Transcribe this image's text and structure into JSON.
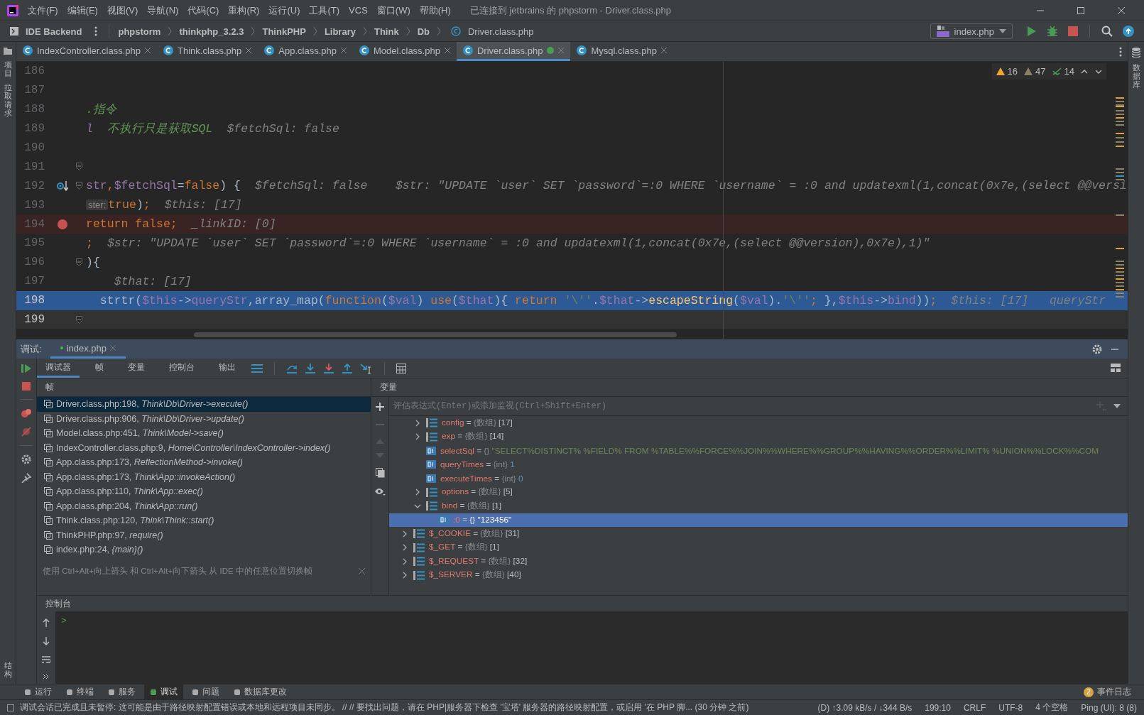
{
  "menu_bar": {
    "items": [
      "文件(F)",
      "编辑(E)",
      "视图(V)",
      "导航(N)",
      "代码(C)",
      "重构(R)",
      "运行(U)",
      "工具(T)",
      "VCS",
      "窗口(W)",
      "帮助(H)"
    ],
    "title": "已连接到 jetbrains 的 phpstorm - Driver.class.php"
  },
  "nav_bar": {
    "project": "IDE Backend",
    "breadcrumbs": [
      "phpstorm",
      "thinkphp_3.2.3",
      "ThinkPHP",
      "Library",
      "Think",
      "Db"
    ],
    "file": "Driver.class.php",
    "run_config": "index.php"
  },
  "side_panels": {
    "left_top": [
      "项目",
      "拉取请求"
    ],
    "left_bottom": [
      "结构"
    ],
    "right": [
      "数据库"
    ]
  },
  "editor_tabs": [
    {
      "label": "IndexController.class.php",
      "selected": false,
      "badge": false
    },
    {
      "label": "Think.class.php",
      "selected": false,
      "badge": false
    },
    {
      "label": "App.class.php",
      "selected": false,
      "badge": false
    },
    {
      "label": "Model.class.php",
      "selected": false,
      "badge": false
    },
    {
      "label": "Driver.class.php",
      "selected": true,
      "badge": true
    },
    {
      "label": "Mysql.class.php",
      "selected": false,
      "badge": false
    }
  ],
  "inspections": {
    "warnings": "16",
    "weak_warnings": "47",
    "typos": "14"
  },
  "code_lines": [
    {
      "number": "186",
      "kind": "plain",
      "fold": false
    },
    {
      "number": "187",
      "kind": "plain",
      "fold": false
    },
    {
      "number": "188",
      "kind": "plain",
      "fold": false,
      "code": [
        {
          "kind": "doc",
          "t": ".指令"
        }
      ]
    },
    {
      "number": "189",
      "kind": "plain",
      "fold": false,
      "code": [
        {
          "kind": "docvar",
          "t": "l"
        },
        {
          "kind": "doc",
          "t": "  不执行只是获取SQL"
        }
      ],
      "hint": "$fetchSql: false"
    },
    {
      "number": "190",
      "kind": "plain",
      "fold": false
    },
    {
      "number": "191",
      "kind": "plain",
      "fold": true
    },
    {
      "number": "192",
      "kind": "step",
      "fold": true,
      "code": [
        {
          "kind": "var",
          "t": "str"
        },
        {
          "kind": "kw",
          "t": ","
        },
        {
          "kind": "var",
          "t": "$fetchSql"
        },
        {
          "kind": "plain",
          "t": "="
        },
        {
          "kind": "kw",
          "t": "false"
        },
        {
          "kind": "plain",
          "t": ") {"
        }
      ],
      "hint": "$fetchSql: false    $str: \"UPDATE `user` SET `password`=:0 WHERE `username` = :0 and updatexml(1,concat(0x7e,(select @@versi"
    },
    {
      "number": "193",
      "kind": "plain",
      "fold": false,
      "inlay": "ster:",
      "code": [
        {
          "kind": "kw",
          "t": "true"
        },
        {
          "kind": "plain",
          "t": ")"
        },
        {
          "kind": "kw",
          "t": ";"
        }
      ],
      "hint": "$this: [17]"
    },
    {
      "number": "194",
      "kind": "breakpoint",
      "fold": false,
      "code": [
        {
          "kind": "kw",
          "t": "return false;"
        }
      ],
      "hint": "_linkID: [0]"
    },
    {
      "number": "195",
      "kind": "plain",
      "fold": false,
      "code": [
        {
          "kind": "kw",
          "t": ";"
        }
      ],
      "hint": "$str: \"UPDATE `user` SET `password`=:0 WHERE `username` = :0 and updatexml(1,concat(0x7e,(select @@version),0x7e),1)\""
    },
    {
      "number": "196",
      "kind": "plain",
      "fold": true,
      "code": [
        {
          "kind": "plain",
          "t": "){"
        }
      ]
    },
    {
      "number": "197",
      "kind": "plain",
      "fold": false,
      "hint": "  $that: [17]"
    },
    {
      "number": "198",
      "kind": "execution",
      "fold": false,
      "code": [
        {
          "kind": "plain",
          "t": "  strtr("
        },
        {
          "kind": "var",
          "t": "$this"
        },
        {
          "kind": "plain",
          "t": "->"
        },
        {
          "kind": "var",
          "t": "queryStr"
        },
        {
          "kind": "plain",
          "t": ",array_map("
        },
        {
          "kind": "kw",
          "t": "function"
        },
        {
          "kind": "plain",
          "t": "("
        },
        {
          "kind": "var",
          "t": "$val"
        },
        {
          "kind": "plain",
          "t": ") "
        },
        {
          "kind": "kw",
          "t": "use"
        },
        {
          "kind": "plain",
          "t": "("
        },
        {
          "kind": "var",
          "t": "$that"
        },
        {
          "kind": "plain",
          "t": "){ "
        },
        {
          "kind": "kw",
          "t": "return "
        },
        {
          "kind": "str",
          "t": "'\\''"
        },
        {
          "kind": "plain",
          "t": "."
        },
        {
          "kind": "var",
          "t": "$that"
        },
        {
          "kind": "plain",
          "t": "->"
        },
        {
          "kind": "method",
          "t": "escapeString"
        },
        {
          "kind": "plain",
          "t": "("
        },
        {
          "kind": "var",
          "t": "$val"
        },
        {
          "kind": "plain",
          "t": ")."
        },
        {
          "kind": "str",
          "t": "'\\''"
        },
        {
          "kind": "kw",
          "t": "; "
        },
        {
          "kind": "plain",
          "t": "},"
        },
        {
          "kind": "var",
          "t": "$this"
        },
        {
          "kind": "plain",
          "t": "->"
        },
        {
          "kind": "var",
          "t": "bind"
        },
        {
          "kind": "plain",
          "t": "))"
        },
        {
          "kind": "kw",
          "t": ";"
        }
      ],
      "hint": "$this: [17]   queryStr"
    },
    {
      "number": "199",
      "kind": "caret",
      "fold": true
    }
  ],
  "debug": {
    "label": "调试:",
    "session": "index.php",
    "tabs": [
      {
        "label": "调试器",
        "selected": true
      },
      {
        "label": "帧",
        "selected": false
      },
      {
        "label": "变量",
        "selected": false
      },
      {
        "label": "控制台",
        "selected": false
      },
      {
        "label": "输出",
        "selected": false
      }
    ],
    "frames_title": "帧",
    "frames": [
      {
        "text": "Driver.class.php:198, *Think\\Db\\Driver->execute()*",
        "selected": true
      },
      {
        "text": "Driver.class.php:906, *Think\\Db\\Driver->update()*",
        "selected": false
      },
      {
        "text": "Model.class.php:451, *Think\\Model->save()*",
        "selected": false
      },
      {
        "text": "IndexController.class.php:9, *Home\\Controller\\IndexController->index()*",
        "selected": false
      },
      {
        "text": "App.class.php:173, *ReflectionMethod->invoke()*",
        "selected": false
      },
      {
        "text": "App.class.php:173, *Think\\App::invokeAction()*",
        "selected": false
      },
      {
        "text": "App.class.php:110, *Think\\App::exec()*",
        "selected": false
      },
      {
        "text": "App.class.php:204, *Think\\App::run()*",
        "selected": false
      },
      {
        "text": "Think.class.php:120, *Think\\Think::start()*",
        "selected": false
      },
      {
        "text": "ThinkPHP.php:97, *require()*",
        "selected": false
      },
      {
        "text": "index.php:24, *{main}()*",
        "selected": false
      }
    ],
    "frames_hint": "使用 Ctrl+Alt+向上箭头 和 Ctrl+Alt+向下箭头 从 IDE 中的任意位置切换帧",
    "variables_title": "变量",
    "eval_placeholder": "评估表达式(Enter)或添加监视(Ctrl+Shift+Enter)",
    "nested_variables": [
      {
        "name": "config",
        "separator": "=",
        "type": "{数组}",
        "value": "[17]",
        "kind": "array",
        "expanded": false,
        "selected": false
      },
      {
        "name": "exp",
        "separator": "=",
        "type": "{数组}",
        "value": "[14]",
        "kind": "array",
        "expanded": false,
        "selected": false
      },
      {
        "name": "selectSql",
        "separator": "=",
        "type": "{}",
        "value": "\"SELECT%DISTINCT% %FIELD% FROM %TABLE%%FORCE%%JOIN%%WHERE%%GROUP%%HAVING%%ORDER%%LIMIT% %UNION%%LOCK%%COM",
        "kind": "string",
        "selected": false
      },
      {
        "name": "queryTimes",
        "separator": "=",
        "type": "{int}",
        "value": "1",
        "kind": "int",
        "selected": false
      },
      {
        "name": "executeTimes",
        "separator": "=",
        "type": "{int}",
        "value": "0",
        "kind": "int",
        "selected": false
      },
      {
        "name": "options",
        "separator": "=",
        "type": "{数组}",
        "value": "[5]",
        "kind": "array",
        "expanded": false,
        "selected": false
      },
      {
        "name": "bind",
        "separator": "=",
        "type": "{数组}",
        "value": "[1]",
        "kind": "array",
        "expanded": true,
        "selected": false,
        "children": [
          {
            "name": ":0",
            "separator": "=",
            "type": "{}",
            "value": "\"123456\"",
            "kind": "string",
            "selected": true
          }
        ]
      }
    ],
    "variables": [
      {
        "name": "$_COOKIE",
        "separator": "=",
        "type": "{数组}",
        "value": "[31]",
        "kind": "array",
        "expanded": false,
        "selected": false
      },
      {
        "name": "$_GET",
        "separator": "=",
        "type": "{数组}",
        "value": "[1]",
        "kind": "array",
        "expanded": false,
        "selected": false
      },
      {
        "name": "$_REQUEST",
        "separator": "=",
        "type": "{数组}",
        "value": "[32]",
        "kind": "array",
        "expanded": false,
        "selected": false
      },
      {
        "name": "$_SERVER",
        "separator": "=",
        "type": "{数组}",
        "value": "[40]",
        "kind": "array",
        "expanded": false,
        "selected": false
      }
    ],
    "console_title": "控制台",
    "prompt": ">"
  },
  "tool_windows": [
    {
      "label": "运行",
      "selected": false
    },
    {
      "label": "终端",
      "selected": false
    },
    {
      "label": "服务",
      "selected": false
    },
    {
      "label": "调试",
      "selected": true
    },
    {
      "label": "问题",
      "selected": false
    },
    {
      "label": "数据库更改",
      "selected": false
    }
  ],
  "event_log": {
    "count": "2",
    "label": "事件日志"
  },
  "status_bar": {
    "message": "调试会话已完成且未暂停: 这可能是由于路径映射配置错误或本地和远程项目未同步。 // // 要找出问题，请在 PHP|服务器下检查 '宝塔' 服务器的路径映射配置，或启用 '在 PHP 脚... (30 分钟 之前)",
    "items": [
      "(D) ↑3.09 kB/s / ↓344 B/s",
      "199:10",
      "CRLF",
      "UTF-8",
      "4 个空格",
      "Ping (UI): 8 (8)"
    ]
  }
}
